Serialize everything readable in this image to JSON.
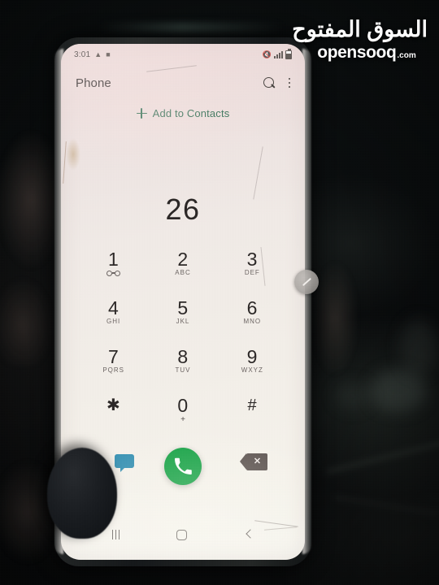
{
  "watermark": {
    "arabic": "السوق المفتوح",
    "latin": "opensooq",
    "suffix": ".com"
  },
  "status_bar": {
    "time": "3:01",
    "warning_icon": "warning-triangle-icon",
    "sd_icon": "sd-card-icon",
    "mute_icon": "mute-icon",
    "signal_icon": "signal-bars-icon",
    "battery_icon": "battery-icon",
    "mute_glyph": "🔇"
  },
  "app_bar": {
    "title": "Phone",
    "search_icon": "search-icon",
    "overflow_icon": "overflow-menu-icon"
  },
  "add_contacts": {
    "label": "Add to Contacts",
    "plus_icon": "plus-icon",
    "color": "#1d6447"
  },
  "dialer": {
    "number": "26"
  },
  "keypad": {
    "rows": [
      [
        {
          "digit": "1",
          "sub": "",
          "icon": "voicemail-icon"
        },
        {
          "digit": "2",
          "sub": "ABC",
          "icon": ""
        },
        {
          "digit": "3",
          "sub": "DEF",
          "icon": ""
        }
      ],
      [
        {
          "digit": "4",
          "sub": "GHI",
          "icon": ""
        },
        {
          "digit": "5",
          "sub": "JKL",
          "icon": ""
        },
        {
          "digit": "6",
          "sub": "MNO",
          "icon": ""
        }
      ],
      [
        {
          "digit": "7",
          "sub": "PQRS",
          "icon": ""
        },
        {
          "digit": "8",
          "sub": "TUV",
          "icon": ""
        },
        {
          "digit": "9",
          "sub": "WXYZ",
          "icon": ""
        }
      ],
      [
        {
          "digit": "✱",
          "sub": "",
          "icon": ""
        },
        {
          "digit": "0",
          "sub": "+",
          "icon": ""
        },
        {
          "digit": "#",
          "sub": "",
          "icon": ""
        }
      ]
    ]
  },
  "actions": {
    "message_icon": "message-bubble-icon",
    "message_color": "#3a93b5",
    "call_icon": "call-icon",
    "call_color": "#16a346",
    "backspace_icon": "backspace-icon",
    "backspace_glyph": "✕",
    "backspace_color": "#5e5552",
    "faint_glyph": "✓"
  },
  "nav_bar": {
    "recents_icon": "recents-icon",
    "home_icon": "home-icon",
    "back_icon": "back-icon"
  },
  "edge_panel": {
    "handle_icon": "edge-panel-pen-handle-icon"
  }
}
